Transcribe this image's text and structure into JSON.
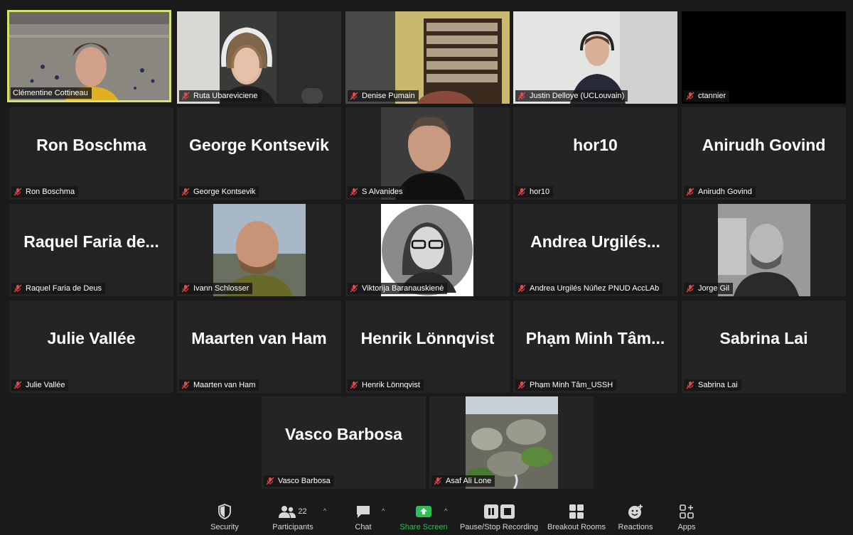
{
  "participants": [
    {
      "name": "Clémentine Cottineau",
      "display": "",
      "video": true,
      "active": true
    },
    {
      "name": "Ruta Ubareviciene",
      "display": "",
      "video": true
    },
    {
      "name": "Denise Pumain",
      "display": "",
      "video": true
    },
    {
      "name": "Justin Delloye (UCLouvain)",
      "display": "",
      "video": true
    },
    {
      "name": "ctannier",
      "display": "",
      "video": true
    },
    {
      "name": "Ron Boschma",
      "display": "Ron Boschma",
      "video": false
    },
    {
      "name": "George Kontsevik",
      "display": "George Kontsevik",
      "video": false
    },
    {
      "name": "S Alvanides",
      "display": "",
      "video": true
    },
    {
      "name": "hor10",
      "display": "hor10",
      "video": false
    },
    {
      "name": "Anirudh Govind",
      "display": "Anirudh Govind",
      "video": false
    },
    {
      "name": "Raquel Faria de Deus",
      "display": "Raquel Faria de...",
      "video": false
    },
    {
      "name": "Ivann Schlosser",
      "display": "",
      "video": true
    },
    {
      "name": "Viktorija Baranauskienė",
      "display": "",
      "video": true
    },
    {
      "name": "Andrea Urgilés Núñez PNUD AccLAb",
      "display": "Andrea Urgilés...",
      "video": false
    },
    {
      "name": "Jorge Gil",
      "display": "",
      "video": true
    },
    {
      "name": "Julie Vallée",
      "display": "Julie Vallée",
      "video": false
    },
    {
      "name": "Maarten van Ham",
      "display": "Maarten van Ham",
      "video": false
    },
    {
      "name": "Henrik Lönnqvist",
      "display": "Henrik Lönnqvist",
      "video": false
    },
    {
      "name": "Phạm Minh Tâm_USSH",
      "display": "Phạm Minh Tâm...",
      "video": false
    },
    {
      "name": "Sabrina Lai",
      "display": "Sabrina Lai",
      "video": false
    },
    {
      "name": "Vasco Barbosa",
      "display": "Vasco Barbosa",
      "video": false
    },
    {
      "name": "Asaf Ali Lone",
      "display": "",
      "video": true
    }
  ],
  "toolbar": {
    "security": "Security",
    "participants": "Participants",
    "participants_count": "22",
    "chat": "Chat",
    "share": "Share Screen",
    "record": "Pause/Stop Recording",
    "breakout": "Breakout Rooms",
    "reactions": "Reactions",
    "apps": "Apps"
  },
  "colors": {
    "active_border": "#d7e36a",
    "share_green": "#2dbf55",
    "mute_red": "#e5484d"
  }
}
